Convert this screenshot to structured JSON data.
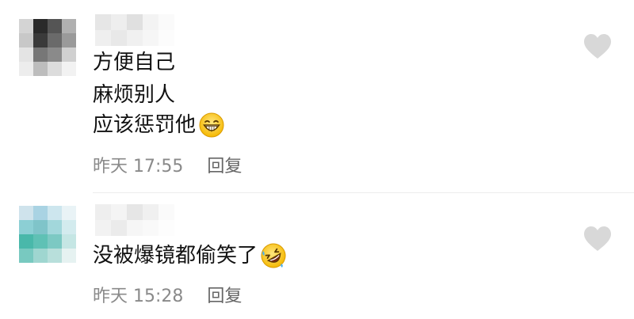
{
  "comments": [
    {
      "lines": [
        "方便自己",
        "麻烦别人",
        "应该惩罚他"
      ],
      "emoji": "grinning-face-emoji",
      "time": "昨天 17:55",
      "reply_label": "回复",
      "like_icon": "heart-icon",
      "avatar_colors": [
        "#d4d4d4",
        "#2a2a2a",
        "#555555",
        "#b0b0b0",
        "#c8c8c8",
        "#3a3a3a",
        "#6a6a6a",
        "#9a9a9a",
        "#e4e4e4",
        "#777777",
        "#8a8a8a",
        "#d0d0d0",
        "#ededed",
        "#bdbdbd",
        "#dcdcdc",
        "#f2f2f2"
      ],
      "username_colors": [
        "#e6e6e6",
        "#eeeeee",
        "#e0e0e0",
        "#f3f3f3",
        "#fafafa",
        "#efefef",
        "#e8e8e8",
        "#f0f0f0",
        "#f6f6f6",
        "#fcfcfc"
      ]
    },
    {
      "lines": [
        "没被爆镜都偷笑了"
      ],
      "emoji": "rolling-on-floor-laughing-emoji",
      "time": "昨天 15:28",
      "reply_label": "回复",
      "like_icon": "heart-icon",
      "avatar_colors": [
        "#cfe3ec",
        "#a9d3e3",
        "#cde6ee",
        "#e9f3f6",
        "#8ccfd4",
        "#7fc4c9",
        "#a2d7db",
        "#d3ebee",
        "#49b8aa",
        "#5fc1b5",
        "#7cc9c3",
        "#c5e6e4",
        "#78c9c0",
        "#9fd6d0",
        "#b8dfdb",
        "#e6f2f1"
      ],
      "username_colors": [
        "#eeeeee",
        "#f4f4f4",
        "#e6e6e6",
        "#f0f0f0",
        "#fafafa",
        "#f2f2f2",
        "#ebebeb",
        "#f6f6f6",
        "#f9f9f9",
        "#fdfdfd"
      ]
    }
  ]
}
